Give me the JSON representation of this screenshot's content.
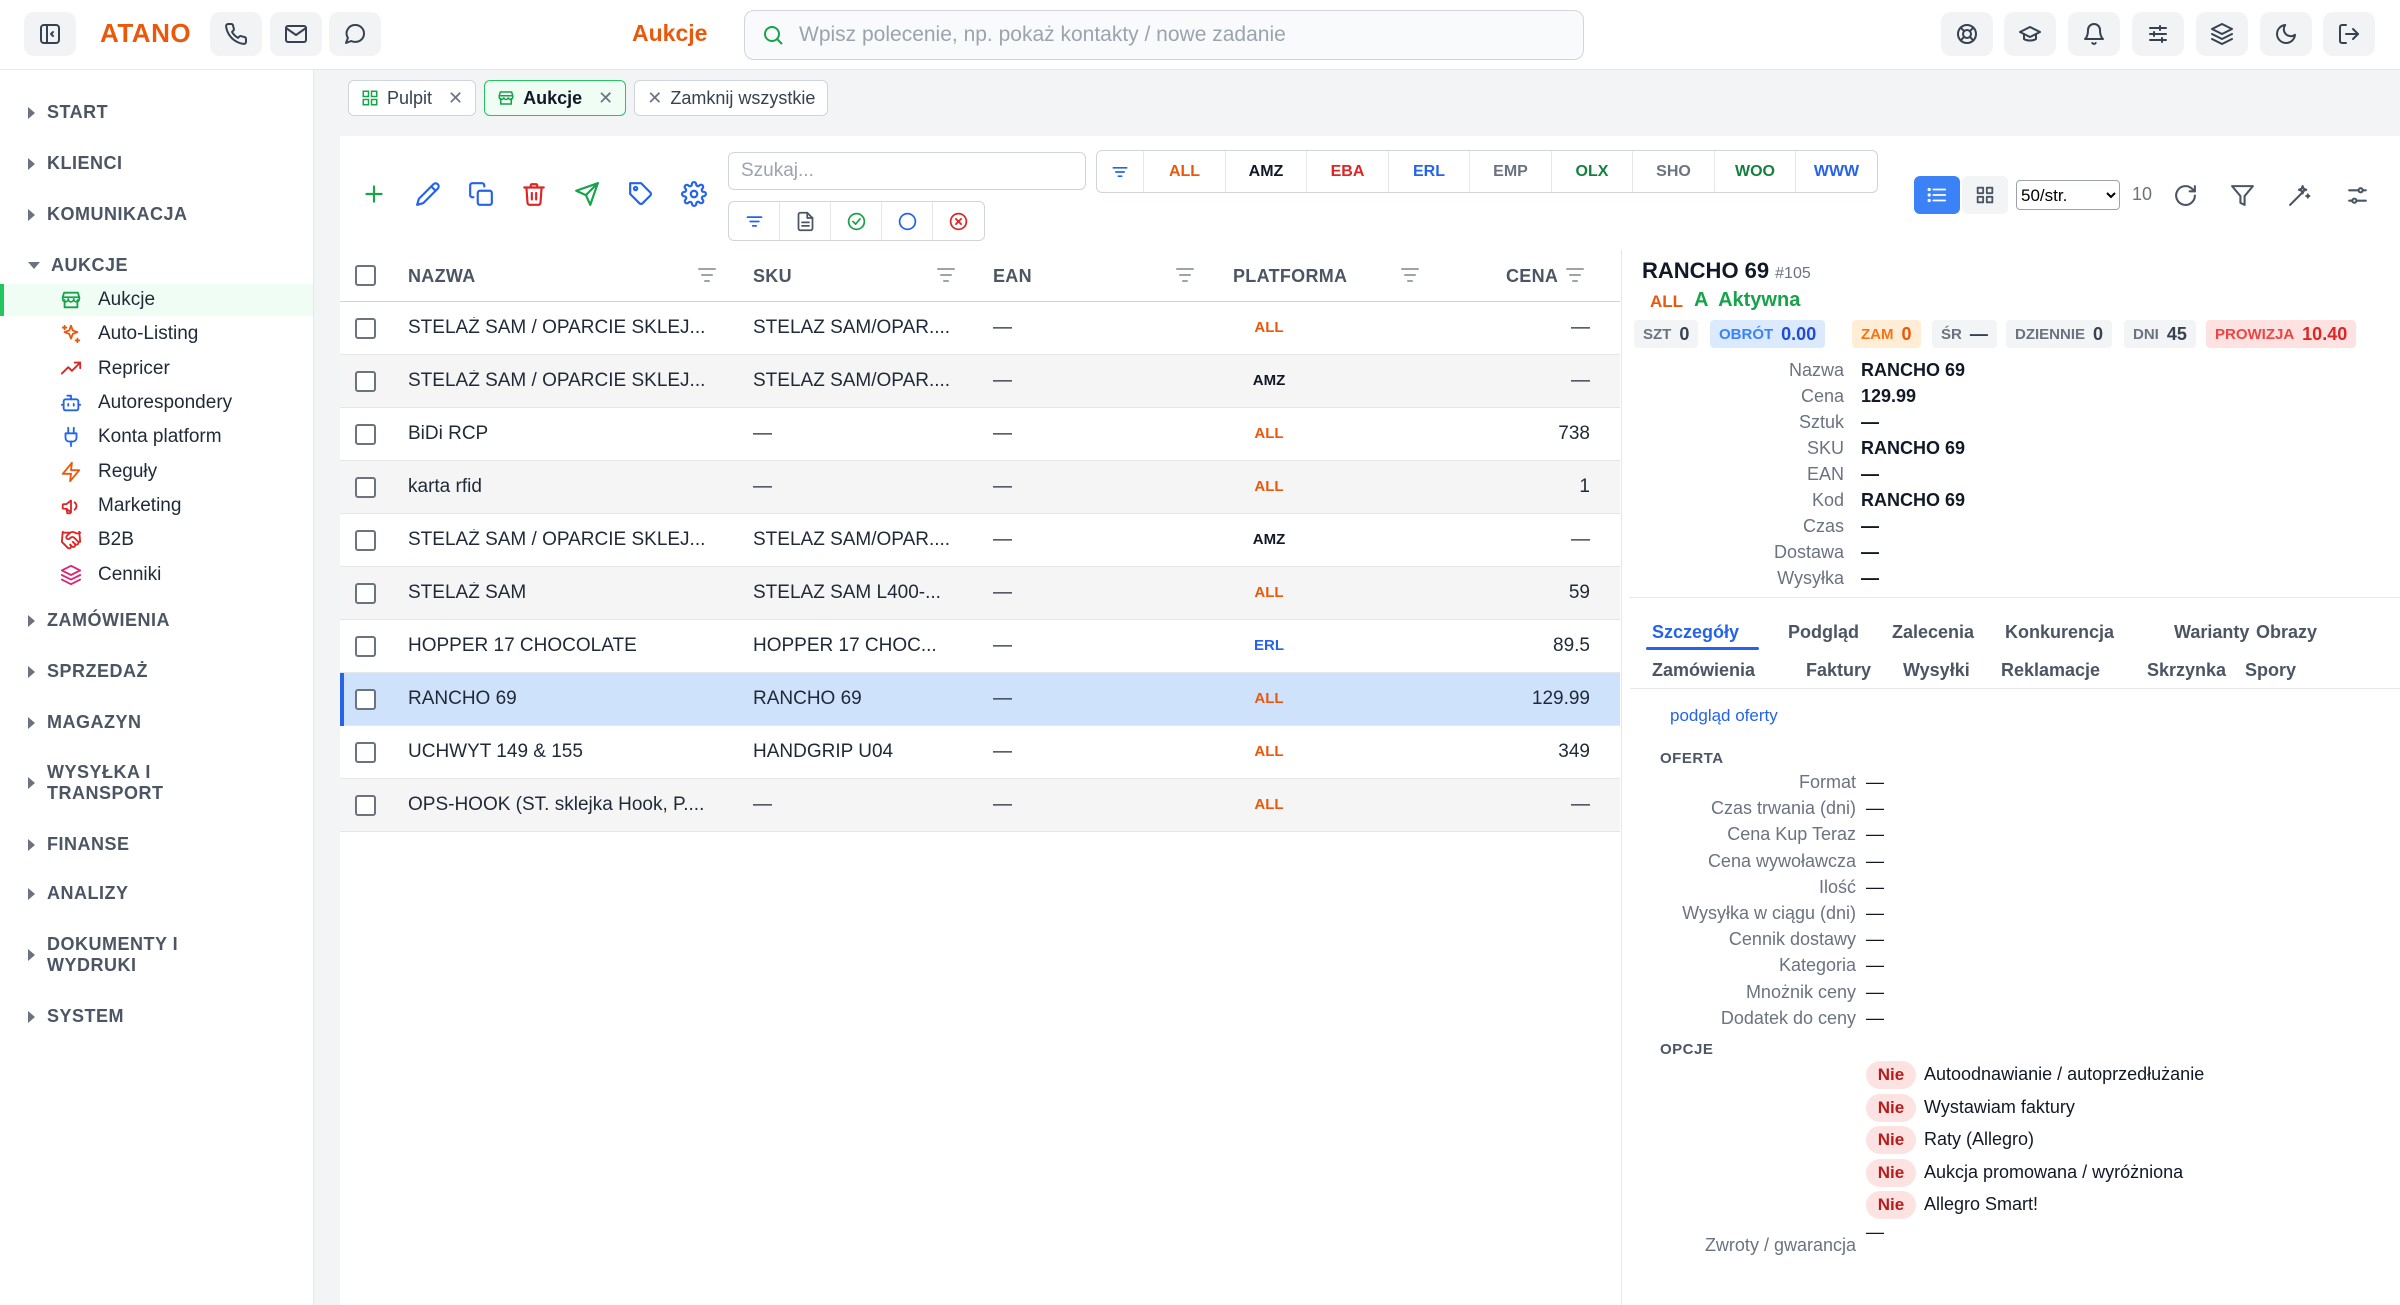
{
  "app": {
    "logo": "ATANO",
    "page_title": "Aukcje"
  },
  "search": {
    "placeholder": "Wpisz polecenie, np. pokaż kontakty / nowe zadanie"
  },
  "topbar_icons": [
    "sidebar-toggle-icon",
    "phone-icon",
    "mail-icon",
    "chat-icon",
    "support-icon",
    "graduation-cap-icon",
    "bell-icon",
    "sliders-icon",
    "layers-icon",
    "moon-icon",
    "logout-icon"
  ],
  "sidebar": {
    "sections_top": [
      "START",
      "KLIENCI",
      "KOMUNIKACJA",
      "AUKCJE"
    ],
    "aukcje_items": [
      {
        "label": "Aukcje",
        "icon": "store-icon",
        "color": "#16a34a"
      },
      {
        "label": "Auto-Listing",
        "icon": "sparkles-icon",
        "color": "#ea580c"
      },
      {
        "label": "Repricer",
        "icon": "trending-icon",
        "color": "#dc2626"
      },
      {
        "label": "Autorespondery",
        "icon": "bot-icon",
        "color": "#2563eb"
      },
      {
        "label": "Konta platform",
        "icon": "plug-icon",
        "color": "#2563eb"
      },
      {
        "label": "Reguły",
        "icon": "zap-icon",
        "color": "#ea580c"
      },
      {
        "label": "Marketing",
        "icon": "megaphone-icon",
        "color": "#dc2626"
      },
      {
        "label": "B2B",
        "icon": "handshake-icon",
        "color": "#dc2626"
      },
      {
        "label": "Cenniki",
        "icon": "layers-icon",
        "color": "#db2777"
      }
    ],
    "sections_bottom": [
      "ZAMÓWIENIA",
      "SPRZEDAŻ",
      "MAGAZYN",
      "WYSYŁKA I",
      "TRANSPORT",
      "FINANSE",
      "ANALIZY",
      "DOKUMENTY I",
      "WYDRUKI",
      "SYSTEM"
    ]
  },
  "tabs": [
    {
      "label": "Pulpit"
    },
    {
      "label": "Aukcje"
    },
    {
      "label": "Zamknij wszystkie"
    }
  ],
  "toolbar": {
    "search_placeholder": "Szukaj...",
    "platforms": [
      {
        "label": "ALL",
        "color": "#ea580c"
      },
      {
        "label": "AMZ",
        "color": "#111827"
      },
      {
        "label": "EBA",
        "color": "#dc2626"
      },
      {
        "label": "ERL",
        "color": "#2563eb"
      },
      {
        "label": "EMP",
        "color": "#6b7280"
      },
      {
        "label": "OLX",
        "color": "#15803d"
      },
      {
        "label": "SHO",
        "color": "#6b7280"
      },
      {
        "label": "WOO",
        "color": "#15803d"
      },
      {
        "label": "WWW",
        "color": "#2563eb"
      }
    ],
    "page_size": "50/str.",
    "count": "10"
  },
  "table": {
    "headers": {
      "name": "NAZWA",
      "sku": "SKU",
      "ean": "EAN",
      "platform": "PLATFORMA",
      "price": "CENA"
    },
    "rows": [
      {
        "name": "STELAŻ SAM / OPARCIE SKLEJ...",
        "sku": "STELAZ SAM/OPAR....",
        "ean": "—",
        "platform": "ALL",
        "pcolor": "#ea580c",
        "price": "—"
      },
      {
        "name": "STELAŻ SAM / OPARCIE SKLEJ...",
        "sku": "STELAZ SAM/OPAR....",
        "ean": "—",
        "platform": "AMZ",
        "pcolor": "#111827",
        "price": "—"
      },
      {
        "name": "BiDi RCP",
        "sku": "—",
        "ean": "—",
        "platform": "ALL",
        "pcolor": "#ea580c",
        "price": "738"
      },
      {
        "name": "karta rfid",
        "sku": "—",
        "ean": "—",
        "platform": "ALL",
        "pcolor": "#ea580c",
        "price": "1"
      },
      {
        "name": "STELAŻ SAM / OPARCIE SKLEJ...",
        "sku": "STELAZ SAM/OPAR....",
        "ean": "—",
        "platform": "AMZ",
        "pcolor": "#111827",
        "price": "—"
      },
      {
        "name": "STELAŻ SAM",
        "sku": "STELAZ SAM L400-...",
        "ean": "—",
        "platform": "ALL",
        "pcolor": "#ea580c",
        "price": "59"
      },
      {
        "name": "HOPPER 17 CHOCOLATE",
        "sku": "HOPPER 17 CHOC...",
        "ean": "—",
        "platform": "ERL",
        "pcolor": "#2563eb",
        "price": "89.5"
      },
      {
        "name": "RANCHO 69",
        "sku": "RANCHO 69",
        "ean": "—",
        "platform": "ALL",
        "pcolor": "#ea580c",
        "price": "129.99"
      },
      {
        "name": "UCHWYT 149 & 155",
        "sku": "HANDGRIP U04",
        "ean": "—",
        "platform": "ALL",
        "pcolor": "#ea580c",
        "price": "349"
      },
      {
        "name": "OPS-HOOK (ST. sklejka Hook, P....",
        "sku": "—",
        "ean": "—",
        "platform": "ALL",
        "pcolor": "#ea580c",
        "price": "—"
      }
    ]
  },
  "detail": {
    "title": "RANCHO 69",
    "id": "#105",
    "platform": "ALL",
    "status": "A  Aktywna",
    "chips": [
      {
        "k": "SZT",
        "v": "0",
        "bg": "#f3f4f6",
        "kc": "#6b7280",
        "vc": "#374151"
      },
      {
        "k": "OBRÓT",
        "v": "0.00",
        "bg": "#dbeafe",
        "kc": "#3b82f6",
        "vc": "#1d4ed8"
      },
      {
        "k": "ZAM",
        "v": "0",
        "bg": "#ffedd5",
        "kc": "#f97316",
        "vc": "#ea580c"
      },
      {
        "k": "ŚR",
        "v": "—",
        "bg": "#f3f4f6",
        "kc": "#6b7280",
        "vc": "#374151"
      },
      {
        "k": "DZIENNIE",
        "v": "0",
        "bg": "#f3f4f6",
        "kc": "#6b7280",
        "vc": "#374151"
      },
      {
        "k": "DNI",
        "v": "45",
        "bg": "#f3f4f6",
        "kc": "#6b7280",
        "vc": "#374151"
      },
      {
        "k": "PROWIZJA",
        "v": "10.40",
        "bg": "#fee2e2",
        "kc": "#ef4444",
        "vc": "#dc2626"
      }
    ],
    "fields": [
      {
        "k": "Nazwa",
        "v": "RANCHO 69"
      },
      {
        "k": "Cena",
        "v": "129.99"
      },
      {
        "k": "Sztuk",
        "v": "—"
      },
      {
        "k": "SKU",
        "v": "RANCHO 69"
      },
      {
        "k": "EAN",
        "v": "—"
      },
      {
        "k": "Kod",
        "v": "RANCHO 69"
      },
      {
        "k": "Czas",
        "v": "—"
      },
      {
        "k": "Dostawa",
        "v": "—"
      },
      {
        "k": "Wysyłka",
        "v": "—"
      }
    ],
    "tabs_row1": [
      "Szczegóły",
      "Podgląd",
      "Zalecenia",
      "Konkurencja",
      "Warianty",
      "Obrazy"
    ],
    "tabs_row2": [
      "Zamówienia",
      "Faktury",
      "Wysyłki",
      "Reklamacje",
      "Skrzynka",
      "Spory"
    ],
    "preview_link": "podgląd oferty",
    "offer_header": "OFERTA",
    "offer": [
      {
        "k": "Format",
        "v": "—"
      },
      {
        "k": "Czas trwania (dni)",
        "v": "—"
      },
      {
        "k": "Cena Kup Teraz",
        "v": "—"
      },
      {
        "k": "Cena wywoławcza",
        "v": "—"
      },
      {
        "k": "Ilość",
        "v": "—"
      },
      {
        "k": "Wysyłka w ciągu (dni)",
        "v": "—"
      },
      {
        "k": "Cennik dostawy",
        "v": "—"
      },
      {
        "k": "Kategoria",
        "v": "—"
      },
      {
        "k": "Mnożnik ceny",
        "v": "—"
      },
      {
        "k": "Dodatek do ceny",
        "v": "—"
      }
    ],
    "options_header": "OPCJE",
    "options": [
      {
        "badge": "Nie",
        "label": "Autoodnawianie / autoprzedłużanie"
      },
      {
        "badge": "Nie",
        "label": "Wystawiam faktury"
      },
      {
        "badge": "Nie",
        "label": "Raty (Allegro)"
      },
      {
        "badge": "Nie",
        "label": "Aukcja promowana / wyróżniona"
      },
      {
        "badge": "Nie",
        "label": "Allegro Smart!"
      }
    ],
    "returns": {
      "k": "Zwroty / gwarancja",
      "v": "—"
    }
  }
}
